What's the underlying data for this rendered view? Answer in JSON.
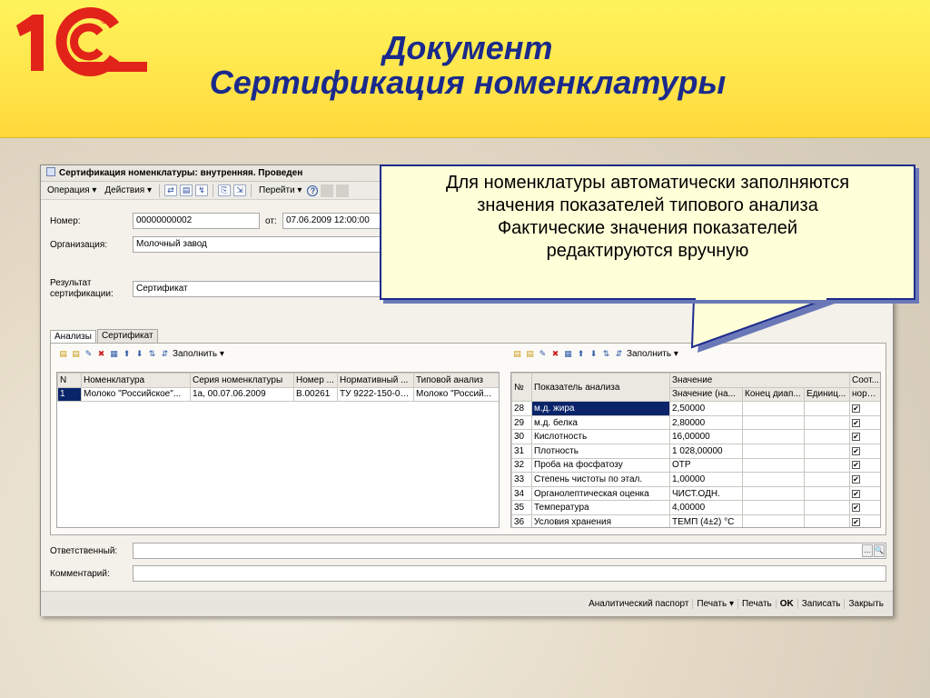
{
  "slide": {
    "title_line1": "Документ",
    "title_line2": "Сертификация номенклатуры",
    "logo_text": "1С",
    "logo_mark": "®"
  },
  "window": {
    "title": "Сертификация номенклатуры: внутренняя. Проведен",
    "toolbar": {
      "operation": "Операция ▾",
      "actions": "Действия ▾",
      "goto": "Перейти ▾",
      "help": "?"
    },
    "header": {
      "number_label": "Номер:",
      "number_value": "00000000002",
      "date_label": "от:",
      "date_value": "07.06.2009 12:00:00",
      "org_label": "Организация:",
      "org_value": "Молочный завод",
      "result_label_1": "Результат",
      "result_label_2": "сертификации:",
      "result_value": "Сертификат"
    },
    "tabs": [
      "Анализы",
      "Сертификат"
    ],
    "fill_label": "Заполнить ▾",
    "left_table": {
      "columns": [
        "N",
        "Номенклатура",
        "Серия номенклатуры",
        "Номер ...",
        "Нормативный ...",
        "Типовой анализ"
      ],
      "rows": [
        [
          "1",
          "Молоко \"Российское\"...",
          "1а, 00.07.06.2009",
          "В.00261",
          "ТУ 9222-150-00...",
          "Молоко \"Россий..."
        ]
      ]
    },
    "right_table": {
      "col_num": "№",
      "col_indicator": "Показатель анализа",
      "col_value": "Значение",
      "col_value_sub": "Значение (на...",
      "col_range_end": "Конец диап...",
      "col_unit": "Единиц...",
      "col_norm_1": "Соот...",
      "col_norm_2": "норм...",
      "rows": [
        {
          "n": "28",
          "name": "м.д. жира",
          "value": "2,50000",
          "check": "✔"
        },
        {
          "n": "29",
          "name": "м.д. белка",
          "value": "2,80000",
          "check": "✔"
        },
        {
          "n": "30",
          "name": "Кислотность",
          "value": "16,00000",
          "check": "✔"
        },
        {
          "n": "31",
          "name": "Плотность",
          "value": "1 028,00000",
          "check": "✔"
        },
        {
          "n": "32",
          "name": "Проба на фосфатозу",
          "value": "ОТР",
          "check": "✔"
        },
        {
          "n": "33",
          "name": "Степень чистоты по этал.",
          "value": "1,00000",
          "check": "✔"
        },
        {
          "n": "34",
          "name": "Органолептическая оценка",
          "value": "ЧИСТ.ОДН.",
          "check": "✔"
        },
        {
          "n": "35",
          "name": "Температура",
          "value": "4,00000",
          "check": "✔"
        },
        {
          "n": "36",
          "name": "Условия хранения",
          "value": "ТЕМП (4±2) °С",
          "check": "✔"
        }
      ]
    },
    "responsible_label": "Ответственный:",
    "responsible_value": "",
    "responsible_btn1": "...",
    "responsible_btn2": "🔍",
    "comment_label": "Комментарий:",
    "comment_value": "",
    "footer": {
      "analytic_passport": "Аналитический паспорт",
      "print_menu": "Печать ▾",
      "print": "Печать",
      "ok": "OK",
      "save": "Записать",
      "close": "Закрыть"
    }
  },
  "callout": {
    "line1": "Для номенклатуры автоматически заполняются",
    "line2": "значения показателей типового анализа",
    "line3": "Фактические значения показателей",
    "line4": "редактируются вручную"
  },
  "colors": {
    "title": "#1a2a8c",
    "logo_red": "#e2231a",
    "header_yellow": "#ffe44a",
    "selection": "#0a246a",
    "callout_bg": "#ffffd8",
    "callout_border": "#1c2c8c"
  }
}
